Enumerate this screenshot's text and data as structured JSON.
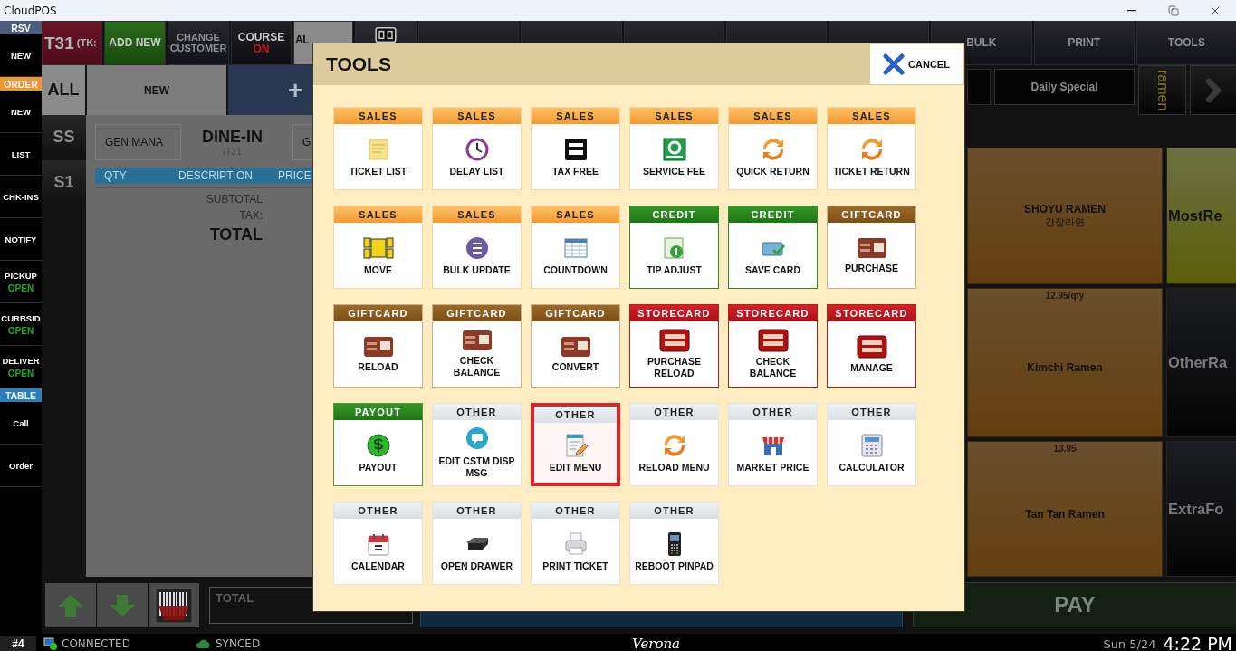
{
  "window": {
    "title": "CloudPOS"
  },
  "sidebar": {
    "items": [
      {
        "kind": "header",
        "label": "RSV",
        "color": "#4e5d7e"
      },
      {
        "kind": "button",
        "label": "NEW"
      },
      {
        "kind": "header",
        "label": "ORDER",
        "color": "#f0962e"
      },
      {
        "kind": "button",
        "label": "NEW"
      },
      {
        "kind": "button",
        "label": "LIST"
      },
      {
        "kind": "button",
        "label": "CHK-INS"
      },
      {
        "kind": "button",
        "label": "NOTIFY"
      },
      {
        "kind": "button",
        "label": "PICKUP",
        "status": "OPEN"
      },
      {
        "kind": "button",
        "label": "CURBSID",
        "status": "OPEN"
      },
      {
        "kind": "button",
        "label": "DELIVER",
        "status": "OPEN"
      },
      {
        "kind": "header",
        "label": "TABLE",
        "color": "#2a7fb8"
      },
      {
        "kind": "button",
        "label": "Call"
      },
      {
        "kind": "button",
        "label": "Order"
      }
    ]
  },
  "top_bar": {
    "buttons": [
      {
        "kind": "ticket",
        "label": "T31",
        "sub": "(TK:"
      },
      {
        "kind": "green",
        "label": "ADD NEW"
      },
      {
        "kind": "dark",
        "label": "CHANGE CUSTOMER"
      },
      {
        "kind": "course",
        "label": "COURSE",
        "sub": "ON"
      },
      {
        "kind": "gray",
        "label": "AL"
      },
      {
        "kind": "icon"
      },
      {
        "kind": "dark"
      },
      {
        "kind": "dark"
      },
      {
        "kind": "dark"
      },
      {
        "kind": "dark"
      },
      {
        "kind": "dark"
      },
      {
        "kind": "dark",
        "label": "BULK"
      },
      {
        "kind": "dark",
        "label": "PRINT"
      },
      {
        "kind": "dark",
        "label": "TOOLS"
      }
    ]
  },
  "order_tabs": [
    {
      "label": "ALL"
    },
    {
      "label": "NEW"
    },
    {
      "label": "+"
    }
  ],
  "seats": [
    {
      "label": "SS"
    },
    {
      "label": "S1"
    }
  ],
  "order": {
    "server_button": "GEN MANA",
    "order_type": "DINE-IN",
    "table": "/T31",
    "guest_button": "G",
    "columns": [
      "QTY",
      "DESCRIPTION",
      "PRICE"
    ],
    "subtotal_label": "SUBTOTAL",
    "tax_label": "TAX:",
    "total_label": "TOTAL"
  },
  "bottom_left": {
    "total_field": "TOTAL"
  },
  "menu_bar": {
    "daily_special": "Daily Special",
    "group_tab": "ramen"
  },
  "menu_items": [
    {
      "name": "SHOYU RAMEN",
      "subtitle": "간장라면"
    },
    {
      "name": "Kimchi Ramen",
      "price": "12.95/qty"
    },
    {
      "name": "Tan Tan Ramen",
      "price": "13.95"
    }
  ],
  "categories": [
    {
      "label": "MostRe",
      "selected": true
    },
    {
      "label": "OtherRa",
      "selected": false
    },
    {
      "label": "ExtraFo",
      "selected": false
    }
  ],
  "pay_button": "PAY",
  "status_bar": {
    "station": "#4",
    "connection": "CONNECTED",
    "sync": "SYNCED",
    "location": "Verona",
    "date": "Sun 5/24",
    "time": "4:22 PM"
  },
  "tools_dialog": {
    "title": "TOOLS",
    "cancel_label": "CANCEL",
    "tiles": [
      {
        "kind": "sales",
        "category": "SALES",
        "label": "TICKET LIST",
        "selected": false
      },
      {
        "kind": "sales",
        "category": "SALES",
        "label": "DELAY LIST",
        "selected": false
      },
      {
        "kind": "sales",
        "category": "SALES",
        "label": "TAX FREE",
        "selected": false
      },
      {
        "kind": "sales",
        "category": "SALES",
        "label": "SERVICE FEE",
        "selected": false
      },
      {
        "kind": "sales",
        "category": "SALES",
        "label": "QUICK RETURN",
        "selected": false
      },
      {
        "kind": "sales",
        "category": "SALES",
        "label": "TICKET RETURN",
        "selected": false
      },
      {
        "kind": "sales",
        "category": "SALES",
        "label": "MOVE",
        "selected": false
      },
      {
        "kind": "sales",
        "category": "SALES",
        "label": "BULK UPDATE",
        "selected": false
      },
      {
        "kind": "sales",
        "category": "SALES",
        "label": "COUNTDOWN",
        "selected": false
      },
      {
        "kind": "credit",
        "category": "CREDIT",
        "label": "TIP ADJUST",
        "selected": false
      },
      {
        "kind": "credit",
        "category": "CREDIT",
        "label": "SAVE CARD",
        "selected": false
      },
      {
        "kind": "giftcard",
        "category": "GIFTCARD",
        "label": "PURCHASE",
        "selected": false
      },
      {
        "kind": "giftcard",
        "category": "GIFTCARD",
        "label": "RELOAD",
        "selected": false
      },
      {
        "kind": "giftcard",
        "category": "GIFTCARD",
        "label": "CHECK BALANCE",
        "selected": false
      },
      {
        "kind": "giftcard",
        "category": "GIFTCARD",
        "label": "CONVERT",
        "selected": false
      },
      {
        "kind": "storecard",
        "category": "STORECARD",
        "label": "PURCHASE RELOAD",
        "selected": false
      },
      {
        "kind": "storecard",
        "category": "STORECARD",
        "label": "CHECK BALANCE",
        "selected": false
      },
      {
        "kind": "storecard",
        "category": "STORECARD",
        "label": "MANAGE",
        "selected": false
      },
      {
        "kind": "payout",
        "category": "PAYOUT",
        "label": "PAYOUT",
        "selected": false
      },
      {
        "kind": "other",
        "category": "OTHER",
        "label": "EDIT CSTM DISP MSG",
        "selected": false
      },
      {
        "kind": "other",
        "category": "OTHER",
        "label": "EDIT MENU",
        "selected": true
      },
      {
        "kind": "other",
        "category": "OTHER",
        "label": "RELOAD MENU",
        "selected": false
      },
      {
        "kind": "other",
        "category": "OTHER",
        "label": "MARKET PRICE",
        "selected": false
      },
      {
        "kind": "other",
        "category": "OTHER",
        "label": "CALCULATOR",
        "selected": false
      },
      {
        "kind": "other",
        "category": "OTHER",
        "label": "CALENDAR",
        "selected": false
      },
      {
        "kind": "other",
        "category": "OTHER",
        "label": "OPEN DRAWER",
        "selected": false
      },
      {
        "kind": "other",
        "category": "OTHER",
        "label": "PRINT TICKET",
        "selected": false
      },
      {
        "kind": "other",
        "category": "OTHER",
        "label": "REBOOT PINPAD",
        "selected": false
      }
    ]
  }
}
